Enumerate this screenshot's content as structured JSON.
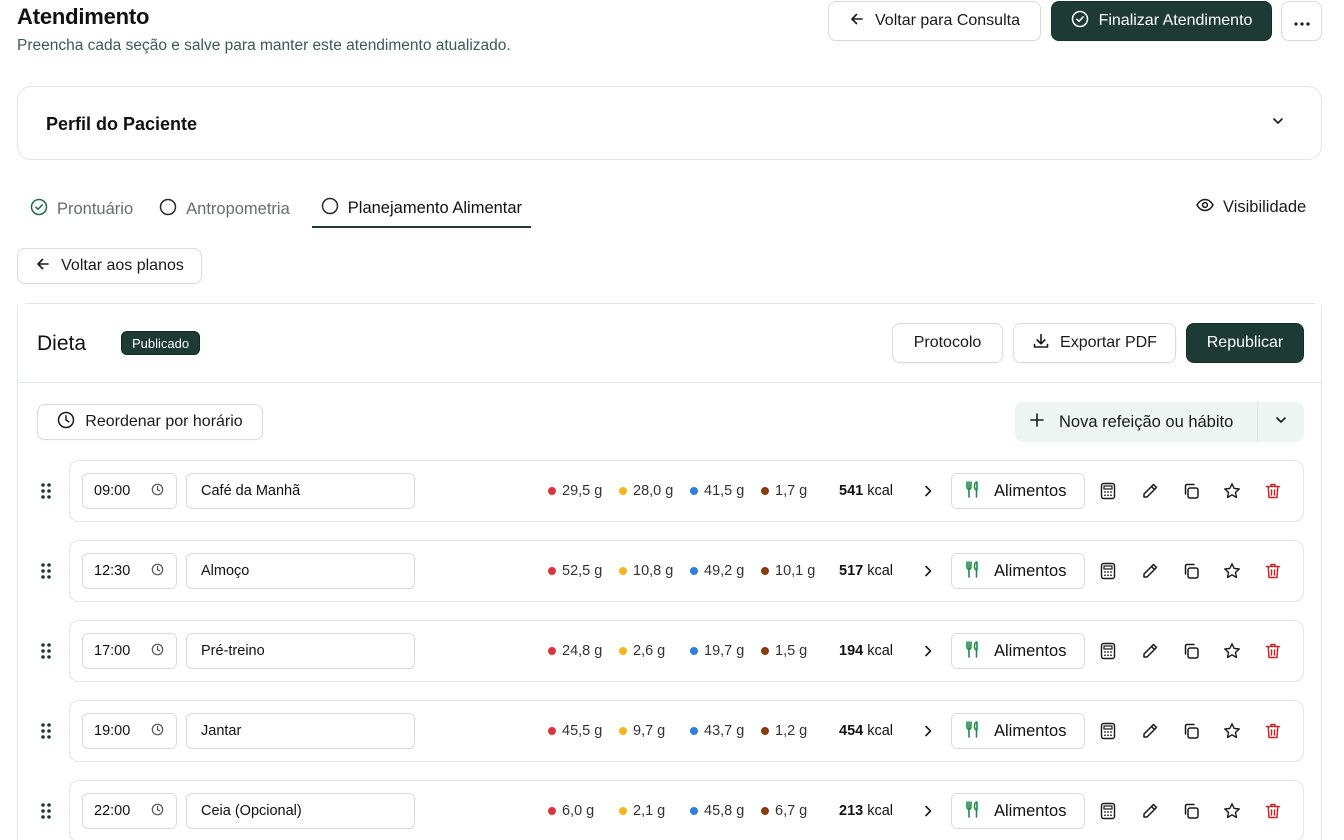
{
  "header": {
    "title": "Atendimento",
    "subtitle": "Preencha cada seção e salve para manter este atendimento atualizado.",
    "back_label": "Voltar para Consulta",
    "finish_label": "Finalizar Atendimento"
  },
  "profile": {
    "title": "Perfil do Paciente"
  },
  "tabs": [
    {
      "label": "Prontuário",
      "state": "done"
    },
    {
      "label": "Antropometria",
      "state": "pending"
    },
    {
      "label": "Planejamento Alimentar",
      "state": "active"
    }
  ],
  "visibility_label": "Visibilidade",
  "back_plans_label": "Voltar aos planos",
  "diet": {
    "title": "Dieta",
    "badge": "Publicado",
    "protocol_label": "Protocolo",
    "export_label": "Exportar PDF",
    "republish_label": "Republicar",
    "reorder_label": "Reordenar por horário",
    "new_meal_label": "Nova refeição ou hábito",
    "foods_label": "Alimentos",
    "kcal_unit": "kcal"
  },
  "colors": {
    "primary": "#1d3a35",
    "protein": "#e0333d",
    "carb": "#f2b51b",
    "fat": "#2f7ee0",
    "fiber": "#8a3a12",
    "foods_icon": "#1f8a4c",
    "delete": "#c62828"
  },
  "meals": [
    {
      "time": "09:00",
      "name": "Café da Manhã",
      "m1": "29,5 g",
      "m2": "28,0 g",
      "m3": "41,5 g",
      "m4": "1,7 g",
      "kcal": "541"
    },
    {
      "time": "12:30",
      "name": "Almoço",
      "m1": "52,5 g",
      "m2": "10,8 g",
      "m3": "49,2 g",
      "m4": "10,1 g",
      "kcal": "517"
    },
    {
      "time": "17:00",
      "name": "Pré-treino",
      "m1": "24,8 g",
      "m2": "2,6 g",
      "m3": "19,7 g",
      "m4": "1,5 g",
      "kcal": "194"
    },
    {
      "time": "19:00",
      "name": "Jantar",
      "m1": "45,5 g",
      "m2": "9,7 g",
      "m3": "43,7 g",
      "m4": "1,2 g",
      "kcal": "454"
    },
    {
      "time": "22:00",
      "name": "Ceia (Opcional)",
      "m1": "6,0 g",
      "m2": "2,1 g",
      "m3": "45,8 g",
      "m4": "6,7 g",
      "kcal": "213"
    }
  ]
}
